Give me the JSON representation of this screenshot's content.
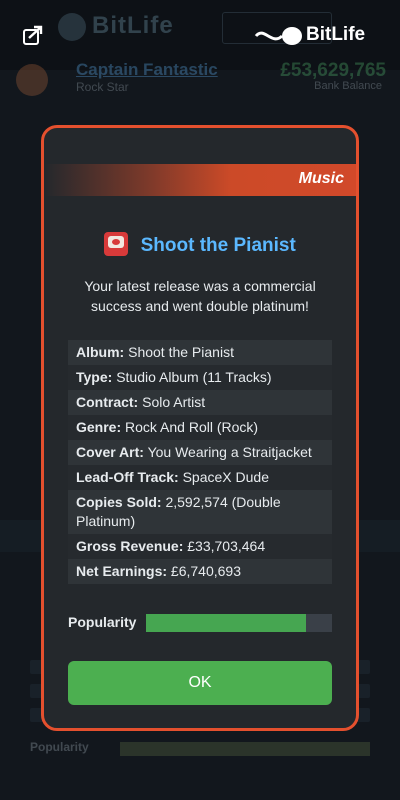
{
  "header": {
    "logo_text": "BitLife",
    "bg_logo_text": "BitLife"
  },
  "profile": {
    "name": "Captain Fantastic",
    "job": "Rock Star",
    "money": "£53,629,765",
    "money_label": "Bank Balance"
  },
  "dialog": {
    "category": "Music",
    "title": "Shoot the Pianist",
    "message": "Your latest release was a commercial success and went double platinum!",
    "details": [
      {
        "key": "Album:",
        "value": "Shoot the Pianist"
      },
      {
        "key": "Type:",
        "value": "Studio Album (11 Tracks)"
      },
      {
        "key": "Contract:",
        "value": "Solo Artist"
      },
      {
        "key": "Genre:",
        "value": "Rock And Roll (Rock)"
      },
      {
        "key": "Cover Art:",
        "value": "You Wearing a Straitjacket"
      },
      {
        "key": "Lead-Off Track:",
        "value": "SpaceX Dude"
      },
      {
        "key": "Copies Sold:",
        "value": "2,592,574 (Double Platinum)"
      },
      {
        "key": "Gross Revenue:",
        "value": "£33,703,464"
      },
      {
        "key": "Net Earnings:",
        "value": "£6,740,693"
      }
    ],
    "popularity_label": "Popularity",
    "popularity_fraction": 0.86,
    "ok_label": "OK"
  },
  "background": {
    "popularity_label": "Popularity"
  },
  "colors": {
    "accent": "#e4502e",
    "title_blue": "#5bb8ff",
    "ok_green": "#4caf50",
    "popularity_green": "#46a651"
  },
  "icons": {
    "share": "share-icon",
    "record": "record-icon"
  }
}
